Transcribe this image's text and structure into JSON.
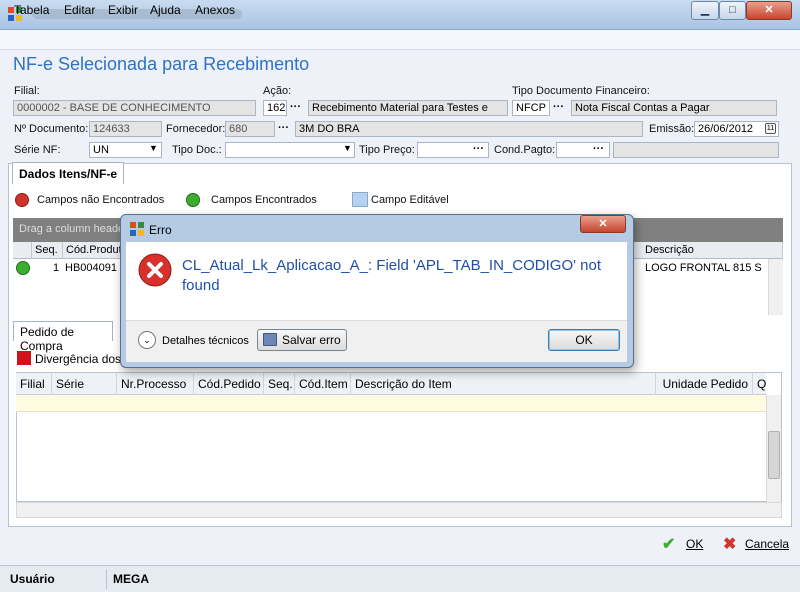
{
  "menu": [
    "Tabela",
    "Editar",
    "Exibir",
    "Ajuda",
    "Anexos"
  ],
  "page_title": "NF-e Selecionada para Recebimento",
  "form": {
    "filial_label": "Filial:",
    "filial_value": "0000002 - BASE DE CONHECIMENTO",
    "acao_label": "Ação:",
    "acao_code": "162",
    "acao_desc": "Recebimento Material para Testes e",
    "tipo_fin_label": "Tipo Documento Financeiro:",
    "tipo_fin_code": "NFCP",
    "tipo_fin_desc": "Nota Fiscal Contas a Pagar",
    "ndoc_label": "Nº Documento:",
    "ndoc_value": "124633",
    "fornecedor_label": "Fornecedor:",
    "fornecedor_code": "680",
    "fornecedor_desc": "3M DO BRA",
    "emissao_label": "Emissão:",
    "emissao_value": "26/06/2012",
    "serie_label": "Série NF:",
    "serie_value": "UN",
    "tipodoc_label": "Tipo Doc.:",
    "tipodoc_value": "",
    "tipopreco_label": "Tipo Preço:",
    "tipopreco_value": "",
    "condpagto_label": "Cond.Pagto:",
    "condpagto_value": ""
  },
  "dots": "···",
  "tabs": {
    "dados": "Dados Itens/NF-e",
    "pedido": "Pedido de Compra"
  },
  "legend": {
    "not_found": "Campos não Encontrados",
    "found": "Campos Encontrados",
    "editable": "Campo Editável"
  },
  "grid": {
    "group_hint": "Drag a column heade",
    "columns": [
      "Seq.",
      "Cód.Produto",
      "Descrição"
    ],
    "row": {
      "seq": "1",
      "code": "HB004091",
      "desc": "LOGO FRONTAL 815 S"
    }
  },
  "divergencia": "Divergência dos I",
  "bottom_grid": {
    "columns": [
      "Filial",
      "Série",
      "Nr.Processo",
      "Cód.Pedido",
      "Seq.",
      "Cód.Item",
      "Descrição do Item",
      "Unidade Pedido",
      "Qt"
    ]
  },
  "footer": {
    "ok": "OK",
    "cancel": "Cancela"
  },
  "status": {
    "user_label": "Usuário",
    "user_value": "MEGA"
  },
  "dialog": {
    "title": "Erro",
    "message": "CL_Atual_Lk_Aplicacao_A_: Field 'APL_TAB_IN_CODIGO' not found",
    "details": "Detalhes técnicos",
    "save": "Salvar erro",
    "ok": "OK"
  },
  "colors": {
    "title_blue": "#2e72c4",
    "error_red": "#d0342c",
    "found_green": "#3cae2f"
  }
}
